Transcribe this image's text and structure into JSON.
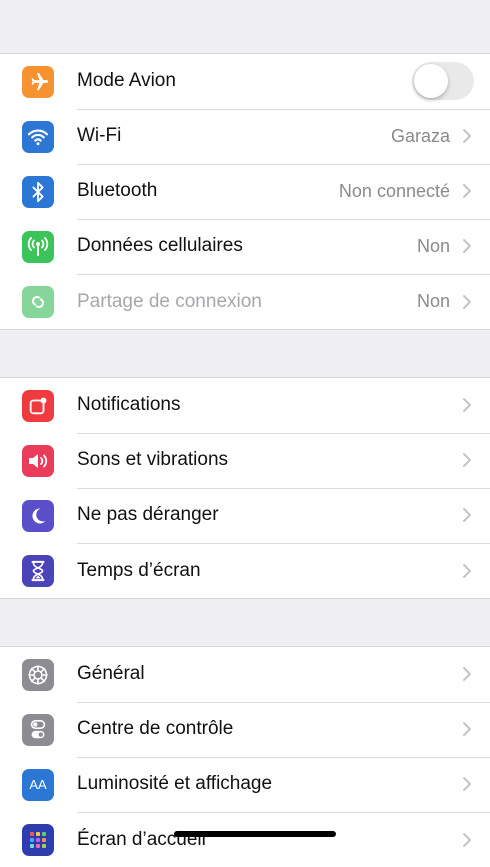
{
  "colors": {
    "airplane": "#f6922f",
    "wifi": "#2b77d3",
    "bluetooth": "#2b77d3",
    "cellular": "#3cc35a",
    "hotspot": "#86d59b",
    "notifications": "#ef3a3f",
    "sounds": "#ea3b5a",
    "dnd": "#5a4fc8",
    "screentime": "#4b43b8",
    "general": "#8c8c92",
    "control": "#8c8c92",
    "display": "#2b77d3",
    "homescreen": "#2d3dae"
  },
  "section1": {
    "airplane": {
      "label": "Mode Avion",
      "icon": "airplane-icon",
      "toggle_on": false
    },
    "wifi": {
      "label": "Wi-Fi",
      "value": "Garaza",
      "icon": "wifi-icon"
    },
    "bluetooth": {
      "label": "Bluetooth",
      "value": "Non connecté",
      "icon": "bluetooth-icon"
    },
    "cellular": {
      "label": "Données cellulaires",
      "value": "Non",
      "icon": "cellular-icon"
    },
    "hotspot": {
      "label": "Partage de connexion",
      "value": "Non",
      "icon": "hotspot-icon"
    }
  },
  "section2": {
    "notifications": {
      "label": "Notifications",
      "icon": "notifications-icon"
    },
    "sounds": {
      "label": "Sons et vibrations",
      "icon": "sounds-icon"
    },
    "dnd": {
      "label": "Ne pas déranger",
      "icon": "moon-icon"
    },
    "screentime": {
      "label": "Temps d’écran",
      "icon": "hourglass-icon"
    }
  },
  "section3": {
    "general": {
      "label": "Général",
      "icon": "gear-icon"
    },
    "control": {
      "label": "Centre de contrôle",
      "icon": "control-center-icon"
    },
    "display": {
      "label": "Luminosité et affichage",
      "icon": "display-icon",
      "icon_text": "AA"
    },
    "homescreen": {
      "label": "Écran d’accueil",
      "icon": "home-screen-icon"
    }
  }
}
